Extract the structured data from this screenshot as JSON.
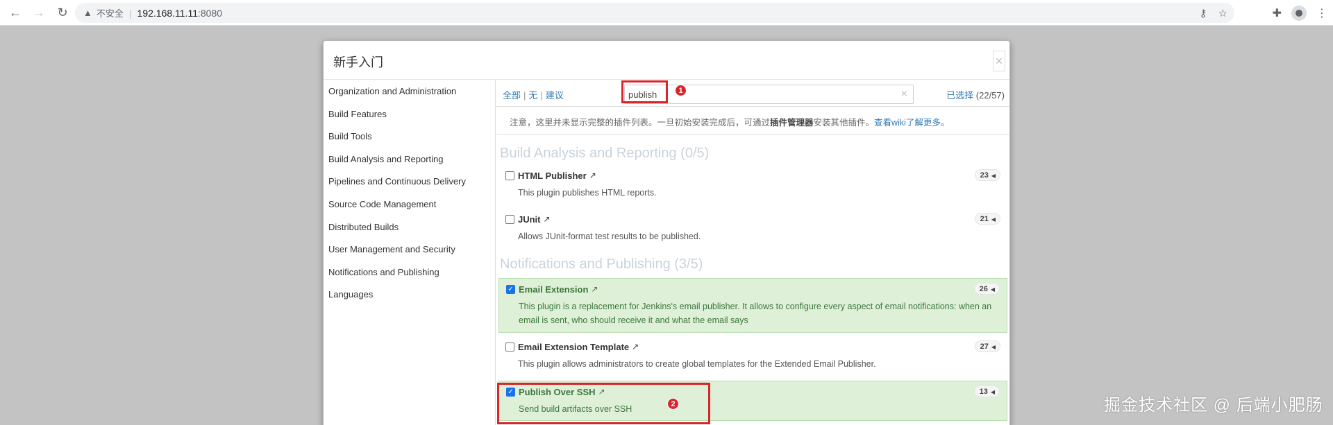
{
  "browser": {
    "insecure_label": "不安全",
    "url_host": "192.168.11.11",
    "url_port": ":8080"
  },
  "dialog": {
    "title": "新手入门",
    "close_label": "×"
  },
  "sidebar": {
    "items": [
      "Organization and Administration",
      "Build Features",
      "Build Tools",
      "Build Analysis and Reporting",
      "Pipelines and Continuous Delivery",
      "Source Code Management",
      "Distributed Builds",
      "User Management and Security",
      "Notifications and Publishing",
      "Languages"
    ]
  },
  "toolbar": {
    "all": "全部",
    "none": "无",
    "suggested": "建议",
    "pipe": "|",
    "search_value": "publish",
    "selected_label": "已选择",
    "selected_count": "(22/57)"
  },
  "notice": {
    "text_before": "注意，这里并未显示完整的插件列表。一旦初始安装完成后，可通过",
    "bold": "插件管理器",
    "text_after": "安装其他插件。",
    "link": "查看wiki了解更多",
    "end": "。"
  },
  "categories": [
    {
      "title": "Build Analysis and Reporting (0/5)",
      "plugins": [
        {
          "name": "HTML Publisher",
          "deps": "23",
          "desc": "This plugin publishes HTML reports.",
          "checked": false
        },
        {
          "name": "JUnit",
          "deps": "21",
          "desc": "Allows JUnit-format test results to be published.",
          "checked": false
        }
      ]
    },
    {
      "title": "Notifications and Publishing (3/5)",
      "plugins": [
        {
          "name": "Email Extension",
          "deps": "26",
          "desc": "This plugin is a replacement for Jenkins's email publisher. It allows to configure every aspect of email notifications: when an email is sent, who should receive it and what the email says",
          "checked": true
        },
        {
          "name": "Email Extension Template",
          "deps": "27",
          "desc": "This plugin allows administrators to create global templates for the Extended Email Publisher.",
          "checked": false
        },
        {
          "name": "Publish Over SSH",
          "deps": "13",
          "desc": "Send build artifacts over SSH",
          "checked": true
        }
      ]
    }
  ],
  "annotations": {
    "marker1": "1",
    "marker2": "2",
    "color": "#d9252b"
  },
  "watermark": "掘金技术社区 @ 后端小肥肠"
}
